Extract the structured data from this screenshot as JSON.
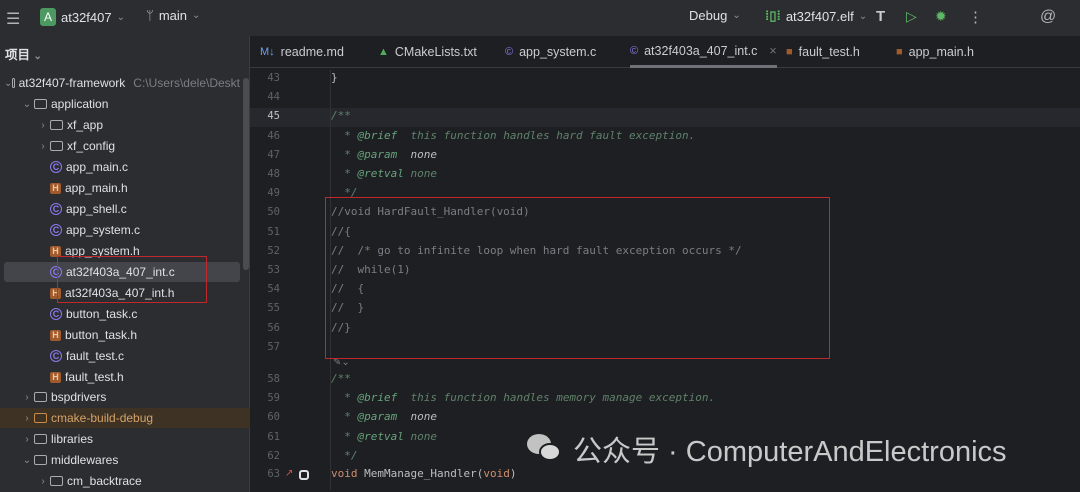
{
  "titlebar": {
    "project_initial": "A",
    "project": "at32f407",
    "branch": "main",
    "config": "Debug",
    "target": "at32f407.elf"
  },
  "sidebar": {
    "title": "项目",
    "items": [
      {
        "label": "at32f407-framework",
        "path": "C:\\Users\\dele\\Deskt",
        "type": "folder",
        "level": 0,
        "arrow": "down"
      },
      {
        "label": "application",
        "type": "folder",
        "level": 1,
        "arrow": "down"
      },
      {
        "label": "xf_app",
        "type": "folder",
        "level": 2,
        "arrow": "right"
      },
      {
        "label": "xf_config",
        "type": "folder",
        "level": 2,
        "arrow": "right"
      },
      {
        "label": "app_main.c",
        "type": "c",
        "level": 2
      },
      {
        "label": "app_main.h",
        "type": "h",
        "level": 2
      },
      {
        "label": "app_shell.c",
        "type": "c",
        "level": 2
      },
      {
        "label": "app_system.c",
        "type": "c",
        "level": 2
      },
      {
        "label": "app_system.h",
        "type": "h",
        "level": 2
      },
      {
        "label": "at32f403a_407_int.c",
        "type": "c",
        "level": 2,
        "selected": true
      },
      {
        "label": "at32f403a_407_int.h",
        "type": "h",
        "level": 2
      },
      {
        "label": "button_task.c",
        "type": "c",
        "level": 2
      },
      {
        "label": "button_task.h",
        "type": "h",
        "level": 2
      },
      {
        "label": "fault_test.c",
        "type": "c",
        "level": 2
      },
      {
        "label": "fault_test.h",
        "type": "h",
        "level": 2
      },
      {
        "label": "bspdrivers",
        "type": "folder",
        "level": 1,
        "arrow": "right"
      },
      {
        "label": "cmake-build-debug",
        "type": "folder-excluded",
        "level": 1,
        "arrow": "right"
      },
      {
        "label": "libraries",
        "type": "folder",
        "level": 1,
        "arrow": "right"
      },
      {
        "label": "middlewares",
        "type": "folder",
        "level": 1,
        "arrow": "down"
      },
      {
        "label": "cm_backtrace",
        "type": "folder",
        "level": 2,
        "arrow": "right"
      }
    ]
  },
  "tabs": [
    {
      "label": "readme.md",
      "icon": "markdown-icon"
    },
    {
      "label": "CMakeLists.txt",
      "icon": "cmake-icon"
    },
    {
      "label": "app_system.c",
      "icon": "c-file-icon"
    },
    {
      "label": "at32f403a_407_int.c",
      "icon": "c-file-icon",
      "active": true,
      "close": "×"
    },
    {
      "label": "fault_test.h",
      "icon": "h-file-icon"
    },
    {
      "label": "app_main.h",
      "icon": "h-file-icon"
    }
  ],
  "editor": {
    "current_line": "45",
    "lines": [
      {
        "n": "43",
        "seg": [
          [
            "}",
            "c-plain"
          ]
        ]
      },
      {
        "n": "44",
        "seg": []
      },
      {
        "n": "45",
        "seg": [
          [
            "/**",
            "c-doc"
          ]
        ]
      },
      {
        "n": "46",
        "seg": [
          [
            "  * ",
            "c-doc"
          ],
          [
            "@brief",
            "c-tag"
          ],
          [
            "  this function handles hard fault exception.",
            "c-doc"
          ]
        ]
      },
      {
        "n": "47",
        "seg": [
          [
            "  * ",
            "c-doc"
          ],
          [
            "@param",
            "c-tag"
          ],
          [
            "  none",
            "c-it"
          ]
        ]
      },
      {
        "n": "48",
        "seg": [
          [
            "  * ",
            "c-doc"
          ],
          [
            "@retval",
            "c-tag"
          ],
          [
            " none",
            "c-doc"
          ]
        ]
      },
      {
        "n": "49",
        "seg": [
          [
            "  */",
            "c-doc"
          ]
        ]
      },
      {
        "n": "50",
        "seg": [
          [
            "//void HardFault_Handler(void)",
            "c-line"
          ]
        ]
      },
      {
        "n": "51",
        "seg": [
          [
            "//{",
            "c-line"
          ]
        ]
      },
      {
        "n": "52",
        "seg": [
          [
            "//  /* go to infinite loop when hard fault exception occurs */",
            "c-line"
          ]
        ]
      },
      {
        "n": "53",
        "seg": [
          [
            "//  while(1)",
            "c-line"
          ]
        ]
      },
      {
        "n": "54",
        "seg": [
          [
            "//  {",
            "c-line"
          ]
        ]
      },
      {
        "n": "55",
        "seg": [
          [
            "//  }",
            "c-line"
          ]
        ]
      },
      {
        "n": "56",
        "seg": [
          [
            "//}",
            "c-line"
          ]
        ]
      },
      {
        "n": "57",
        "seg": []
      },
      {
        "n": "58",
        "seg": [
          [
            "/**",
            "c-doc"
          ]
        ]
      },
      {
        "n": "59",
        "seg": [
          [
            "  * ",
            "c-doc"
          ],
          [
            "@brief",
            "c-tag"
          ],
          [
            "  this function handles memory manage exception.",
            "c-doc"
          ]
        ]
      },
      {
        "n": "60",
        "seg": [
          [
            "  * ",
            "c-doc"
          ],
          [
            "@param",
            "c-tag"
          ],
          [
            "  none",
            "c-it"
          ]
        ]
      },
      {
        "n": "61",
        "seg": [
          [
            "  * ",
            "c-doc"
          ],
          [
            "@retval",
            "c-tag"
          ],
          [
            " none",
            "c-doc"
          ]
        ]
      },
      {
        "n": "62",
        "seg": [
          [
            "  */",
            "c-doc"
          ]
        ]
      },
      {
        "n": "63",
        "seg": [
          [
            "void",
            "c-kw"
          ],
          [
            " MemManage_Handler",
            "c-plain"
          ],
          [
            "(",
            "c-plain"
          ],
          [
            "void",
            "c-kw"
          ],
          [
            ")",
            "c-plain"
          ]
        ]
      }
    ]
  },
  "watermark": {
    "text": "公众号 · ComputerAndElectronics"
  },
  "colors": {
    "highlight_box": "#c0282d",
    "accent_green": "#4c9a62"
  }
}
